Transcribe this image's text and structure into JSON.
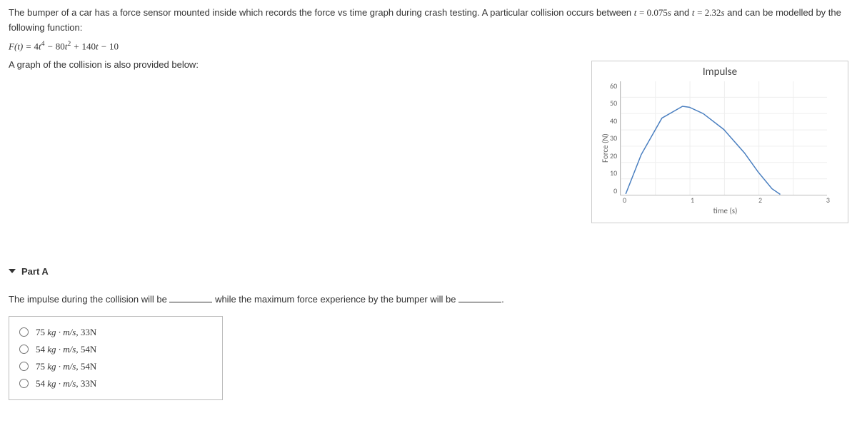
{
  "intro": {
    "line1_pre": "The bumper of a car has a force sensor mounted inside which records the force vs time graph during crash testing. A particular collision occurs between ",
    "t1": "t = 0.075s",
    "and": " and ",
    "t2": "t = 2.32s",
    "line1_post": " and can be modelled by the following function:",
    "equation_plain": "F(t) = 4t⁴ − 80t² + 140t − 10",
    "line2": "A graph of the collision is also provided below:"
  },
  "chart_data": {
    "type": "line",
    "title": "Impulse",
    "xlabel": "time (s)",
    "ylabel": "Force (N)",
    "xlim": [
      0,
      3
    ],
    "ylim": [
      0,
      70
    ],
    "x_ticks": [
      "0",
      "1",
      "2",
      "3"
    ],
    "y_ticks": [
      "60",
      "50",
      "40",
      "30",
      "20",
      "10",
      "0"
    ],
    "x": [
      0.075,
      0.3,
      0.6,
      0.9,
      1.0,
      1.2,
      1.5,
      1.8,
      2.0,
      2.2,
      2.32
    ],
    "values": [
      0.5,
      24.8,
      47.3,
      54.6,
      54.0,
      50.1,
      40.3,
      25.8,
      14.0,
      3.7,
      0.2
    ]
  },
  "part": {
    "label": "Part A",
    "question_pre": "The impulse during the collision will be ",
    "question_mid": " while the maximum force experience by the bumper will be ",
    "question_post": "."
  },
  "options": [
    {
      "impulse": "75",
      "units": "kg · m/s",
      "sep": ", ",
      "force": "33N"
    },
    {
      "impulse": "54",
      "units": "kg · m/s",
      "sep": ", ",
      "force": "54N"
    },
    {
      "impulse": "75",
      "units": "kg · m/s",
      "sep": ", ",
      "force": "54N"
    },
    {
      "impulse": "54",
      "units": "kg · m/s",
      "sep": ", ",
      "force": "33N"
    }
  ]
}
